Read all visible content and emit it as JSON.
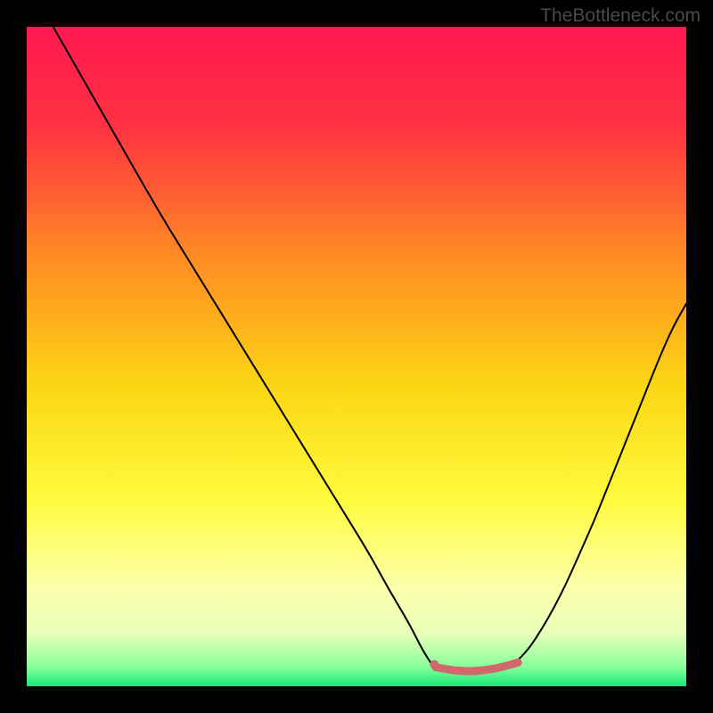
{
  "watermark": "TheBottleneck.com",
  "chart_data": {
    "type": "line",
    "title": "",
    "xlabel": "",
    "ylabel": "",
    "xlim": [
      0,
      100
    ],
    "ylim": [
      0,
      100
    ],
    "grid": false,
    "legend": false,
    "gradient_stops": [
      {
        "offset": 0,
        "color": "#ff1850"
      },
      {
        "offset": 15,
        "color": "#ff3142"
      },
      {
        "offset": 35,
        "color": "#ff8b23"
      },
      {
        "offset": 55,
        "color": "#fbd814"
      },
      {
        "offset": 72,
        "color": "#fefb3e"
      },
      {
        "offset": 85,
        "color": "#fdffac"
      },
      {
        "offset": 92,
        "color": "#e8ffb8"
      },
      {
        "offset": 97,
        "color": "#8aff9a"
      },
      {
        "offset": 100,
        "color": "#16e87a"
      }
    ],
    "series": [
      {
        "name": "left-curve",
        "stroke": "#000000",
        "stroke_width": 2,
        "x": [
          4,
          8,
          12,
          16,
          20,
          24,
          28,
          32,
          36,
          40,
          44,
          48,
          52,
          55,
          58,
          60,
          61.5
        ],
        "y": [
          100,
          93,
          86,
          79,
          72,
          65.5,
          59,
          52.5,
          46,
          39.5,
          33,
          26.5,
          20,
          14.5,
          9.5,
          5.5,
          3.2
        ]
      },
      {
        "name": "right-curve",
        "stroke": "#000000",
        "stroke_width": 2,
        "x": [
          74,
          76,
          78,
          80,
          82,
          84,
          86,
          88,
          90,
          92,
          94,
          96,
          98,
          100
        ],
        "y": [
          3.5,
          5.5,
          8.5,
          12,
          16,
          20.5,
          25,
          30,
          35,
          40,
          45,
          50,
          54.5,
          58
        ]
      },
      {
        "name": "midline-thin",
        "stroke": "#000000",
        "stroke_width": 1,
        "x": [
          61.5,
          63,
          65,
          67,
          69,
          71,
          73,
          74
        ],
        "y": [
          3.2,
          2.6,
          2.3,
          2.2,
          2.3,
          2.6,
          3.1,
          3.5
        ]
      },
      {
        "name": "optimal-segment",
        "stroke": "#d0696d",
        "stroke_width": 9,
        "x": [
          62,
          64,
          66,
          68,
          70,
          72,
          74.5
        ],
        "y": [
          2.9,
          2.5,
          2.3,
          2.3,
          2.5,
          2.9,
          3.6
        ]
      }
    ],
    "marker": {
      "name": "optimal-point",
      "x": 61.8,
      "y": 3.3,
      "color": "#d0696d",
      "radius": 5
    }
  }
}
